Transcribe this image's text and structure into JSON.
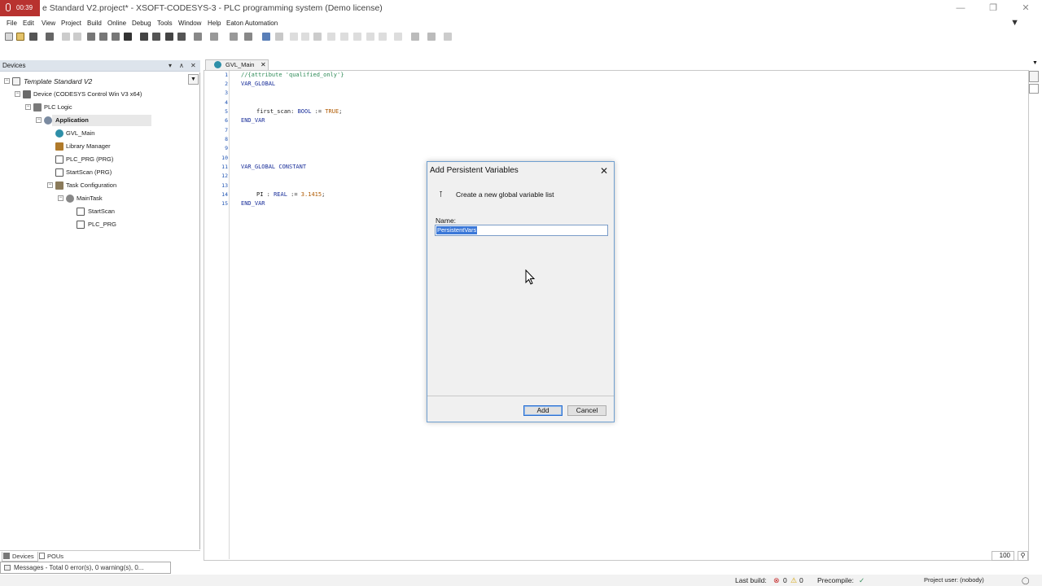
{
  "window": {
    "recording_time": "00:39",
    "title": "e Standard V2.project* - XSOFT-CODESYS-3 - PLC programming system (Demo license)"
  },
  "menu": [
    "File",
    "Edit",
    "View",
    "Project",
    "Build",
    "Online",
    "Debug",
    "Tools",
    "Window",
    "Help",
    "Eaton Automation"
  ],
  "devices_panel": {
    "title": "Devices",
    "tree": [
      {
        "label": "Template Standard V2",
        "icon": "project-icon"
      },
      {
        "label": "Device (CODESYS Control Win V3 x64)",
        "icon": "device-icon"
      },
      {
        "label": "PLC Logic",
        "icon": "plc-logic-icon"
      },
      {
        "label": "Application",
        "icon": "application-gear-icon"
      },
      {
        "label": "GVL_Main",
        "icon": "gvl-icon"
      },
      {
        "label": "Library Manager",
        "icon": "library-icon"
      },
      {
        "label": "PLC_PRG (PRG)",
        "icon": "pou-icon"
      },
      {
        "label": "StartScan (PRG)",
        "icon": "pou-icon"
      },
      {
        "label": "Task Configuration",
        "icon": "task-config-icon"
      },
      {
        "label": "MainTask",
        "icon": "task-icon"
      },
      {
        "label": "StartScan",
        "icon": "task-call-icon"
      },
      {
        "label": "PLC_PRG",
        "icon": "task-call-icon"
      }
    ],
    "tabs": [
      "Devices",
      "POUs"
    ]
  },
  "messages_bar": "Messages - Total 0 error(s), 0 warning(s), 0...",
  "editor": {
    "tab_label": "GVL_Main",
    "line_numbers": [
      "1",
      "2",
      "3",
      "4",
      "5",
      "6",
      "7",
      "8",
      "9",
      "10",
      "11",
      "12",
      "13",
      "14",
      "15"
    ],
    "lines": {
      "l1": "//{attribute 'qualified_only'}",
      "l2": "VAR_GLOBAL",
      "l5a": "first_scan: ",
      "l5b": "BOOL",
      "l5c": " := ",
      "l5d": "TRUE",
      "l5e": ";",
      "l6": "END_VAR",
      "l11": "VAR_GLOBAL CONSTANT",
      "l14a": "PI : ",
      "l14b": "REAL",
      "l14c": " := ",
      "l14d": "3.1415",
      "l14e": ";",
      "l15": "END_VAR"
    },
    "zoom": "100"
  },
  "dialog": {
    "title": "Add Persistent Variables",
    "description": "Create a new global variable list",
    "name_label": "Name:",
    "name_value": "PersistentVars",
    "add_label": "Add",
    "cancel_label": "Cancel"
  },
  "status_bar": {
    "last_build_label": "Last build:",
    "errors": "0",
    "warnings": "0",
    "precompile_label": "Precompile:",
    "project_user": "Project user: (nobody)"
  },
  "colors": {
    "recording": "#b8322f",
    "keyword": "#1a2f9a",
    "comment": "#2e8b57",
    "literal": "#b05a00",
    "selection": "#3b78d8"
  }
}
